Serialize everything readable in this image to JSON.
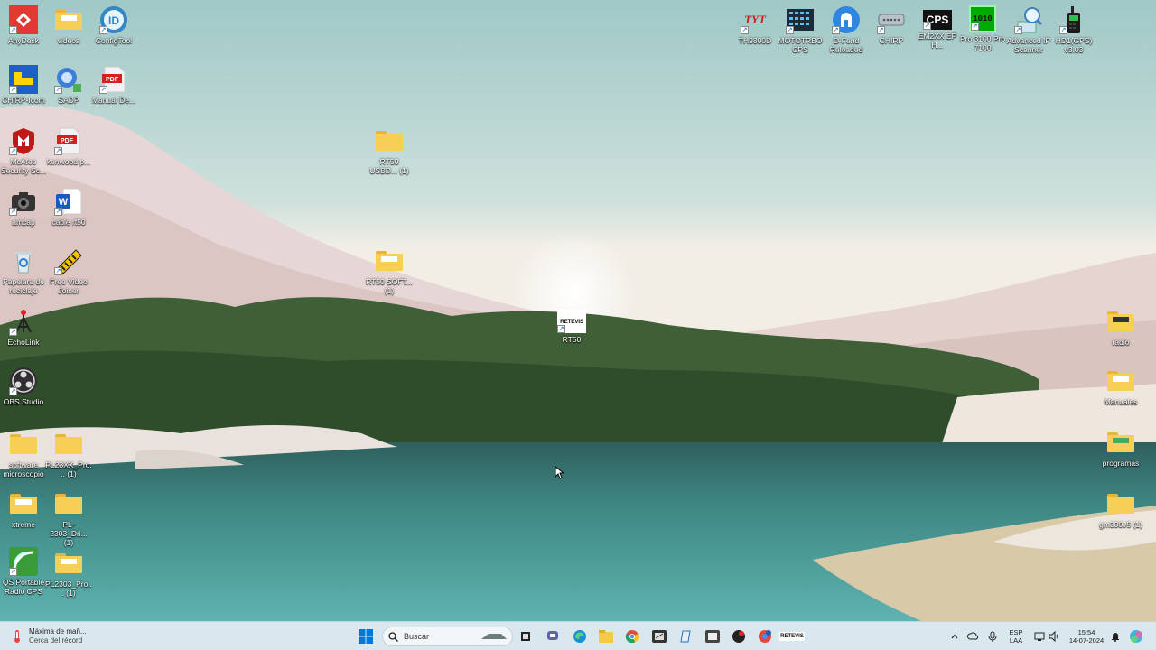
{
  "desktop": {
    "left_column_1": [
      {
        "id": "anydesk",
        "label": "AnyDesk",
        "icon": "anydesk-icon"
      },
      {
        "id": "icom",
        "label": "CHIRP-Icom",
        "icon": "icom-icon"
      },
      {
        "id": "mcafee",
        "label": "McAfee Security Sc...",
        "icon": "mcafee-icon"
      },
      {
        "id": "amcap",
        "label": "amcap",
        "icon": "camera-icon"
      },
      {
        "id": "recycle",
        "label": "Papelera de reciclaje",
        "icon": "recycle-bin-icon"
      },
      {
        "id": "echolink",
        "label": "EchoLink",
        "icon": "echolink-icon"
      },
      {
        "id": "obs",
        "label": "OBS Studio",
        "icon": "obs-icon"
      },
      {
        "id": "software",
        "label": "software microscopio",
        "icon": "folder-icon"
      },
      {
        "id": "xtreme",
        "label": "xtreme",
        "icon": "folder-icon"
      },
      {
        "id": "qsportable",
        "label": "QS Portable Radio CPS",
        "icon": "qs-portable-icon"
      }
    ],
    "left_column_2": [
      {
        "id": "videos",
        "label": "videos",
        "icon": "folder-icon"
      },
      {
        "id": "sadp",
        "label": "SADP",
        "icon": "sadp-icon"
      },
      {
        "id": "kenwood",
        "label": "kenwood p...",
        "icon": "pdf-icon"
      },
      {
        "id": "cable",
        "label": "cable rt50",
        "icon": "word-icon"
      },
      {
        "id": "freevideo",
        "label": "Free Video Joiner",
        "icon": "video-joiner-icon"
      },
      {
        "id": "pl23",
        "label": "PL23XX_Pro... (1)",
        "icon": "folder-icon"
      },
      {
        "id": "pl2303dri",
        "label": "PL-2303_Dri... (1)",
        "icon": "folder-icon"
      },
      {
        "id": "pl2303pro",
        "label": "PL2303_Pro... (1)",
        "icon": "folder-icon"
      }
    ],
    "left_column_3": [
      {
        "id": "configtool",
        "label": "ConfigTool",
        "icon": "configtool-icon"
      },
      {
        "id": "manual",
        "label": "Manual De...",
        "icon": "pdf-icon"
      }
    ],
    "center": [
      {
        "id": "rt50usb",
        "label": "RT50 USBD... (1)",
        "icon": "folder-icon"
      },
      {
        "id": "rt50sof",
        "label": "RT50 SOFT... (1)",
        "icon": "folder-icon"
      },
      {
        "id": "rt50",
        "label": "RT50",
        "icon": "retevis-icon",
        "badge": "RETEVIS"
      }
    ],
    "top_right": [
      {
        "id": "tyt",
        "label": "TH9800D",
        "icon": "tyt-icon",
        "badge": "TYT"
      },
      {
        "id": "motorola",
        "label": "MOTOTRBO CPS",
        "icon": "mototrbo-icon"
      },
      {
        "id": "dfend",
        "label": "D-Fend Reloaded",
        "icon": "dfend-icon"
      },
      {
        "id": "chirp",
        "label": "CHIRP",
        "icon": "chirp-icon"
      },
      {
        "id": "cps",
        "label": "EM2XX EP H...",
        "icon": "cps-icon",
        "badge": "CPS"
      },
      {
        "id": "pro3100",
        "label": "Pro 3100 Pro 7100",
        "icon": "pro3100-icon",
        "badge": "1010"
      },
      {
        "id": "advip",
        "label": "Advanced IP Scanner",
        "icon": "advanced-ip-scanner-icon"
      },
      {
        "id": "hd1",
        "label": "HD1(GPS) v3.03",
        "icon": "hd1-radio-icon"
      }
    ],
    "right_column": [
      {
        "id": "radio",
        "label": "radio",
        "icon": "folder-icon"
      },
      {
        "id": "manuales",
        "label": "Manuales",
        "icon": "folder-icon"
      },
      {
        "id": "programas",
        "label": "programas",
        "icon": "folder-icon"
      },
      {
        "id": "gm300",
        "label": "gm300v5 (1)",
        "icon": "folder-icon"
      }
    ]
  },
  "taskbar": {
    "weather_line1": "Máxima de mañ...",
    "weather_line2": "Cerca del récord",
    "search_placeholder": "Buscar",
    "apps": [
      "start-icon",
      "search-icon",
      "task-view-icon",
      "chat-icon",
      "edge-icon",
      "file-explorer-icon",
      "chrome-icon",
      "app1-icon",
      "app2-icon",
      "app3-icon",
      "app4-icon",
      "app5-icon",
      "retevis-icon"
    ],
    "lang_line1": "ESP",
    "lang_line2": "LAA",
    "time": "15:54",
    "date": "14-07-2024"
  },
  "colors": {
    "taskbar_bg": "#d9e8ee",
    "folder": "#f7cf55",
    "accent_blue": "#0078d4"
  }
}
